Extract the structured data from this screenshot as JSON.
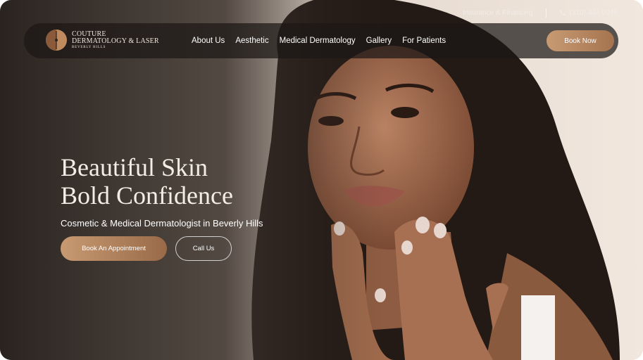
{
  "topbar": {
    "insurance_link": "Insurance & Financing",
    "phone": "(310) 444-0946"
  },
  "logo": {
    "line1": "COUTURE",
    "line2": "DERMATOLOGY & LASER",
    "line3": "BEVERLY HILLS"
  },
  "nav": {
    "items": [
      {
        "label": "About Us"
      },
      {
        "label": "Aesthetic"
      },
      {
        "label": "Medical Dermatology"
      },
      {
        "label": "Gallery"
      },
      {
        "label": "For Patients"
      }
    ],
    "cta": "Book Now"
  },
  "hero": {
    "headline_line1": "Beautiful Skin",
    "headline_line2": "Bold Confidence",
    "subheadline": "Cosmetic & Medical Dermatologist in Beverly Hills",
    "primary_button": "Book An Appointment",
    "secondary_button": "Call Us"
  },
  "colors": {
    "accent_gradient_start": "#c89a72",
    "accent_gradient_end": "#a5744f",
    "nav_background": "#1c1816"
  },
  "icons": {
    "phone": "phone-icon",
    "logo_mark": "logo-mark-icon"
  }
}
